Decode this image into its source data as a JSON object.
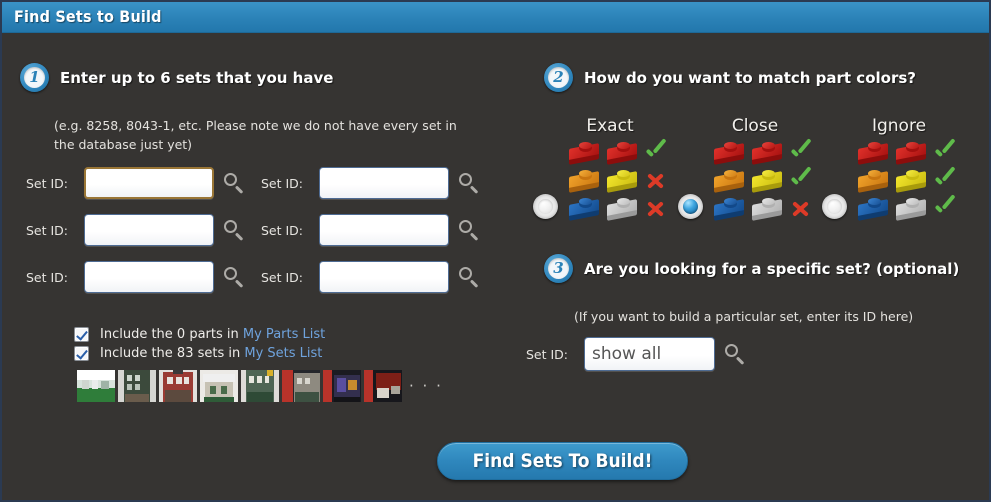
{
  "window": {
    "title": "Find Sets to Build"
  },
  "theme": {
    "titlebar": "#2b82b7",
    "background": "#363432",
    "accent": "#2f87bd",
    "link": "#6fa3dd",
    "focus_border": "#9a7636",
    "tick": "#5fbb4a",
    "cross": "#dd3a27"
  },
  "step1": {
    "number": "1",
    "title": "Enter up to 6 sets that you have",
    "hint": "(e.g. 8258, 8043-1, etc. Please note we do not have every set in the database just yet)",
    "field_label": "Set ID:",
    "fields": [
      {
        "value": "",
        "placeholder": "",
        "focused": true
      },
      {
        "value": "",
        "placeholder": "",
        "focused": false
      },
      {
        "value": "",
        "placeholder": "",
        "focused": false
      },
      {
        "value": "",
        "placeholder": "",
        "focused": false
      },
      {
        "value": "",
        "placeholder": "",
        "focused": false
      },
      {
        "value": "",
        "placeholder": "",
        "focused": false
      }
    ],
    "search_icon": "search-icon",
    "checkboxes": [
      {
        "checked": true,
        "text_before": "Include the 0 parts in",
        "link": "My Parts List"
      },
      {
        "checked": true,
        "text_before": "Include the 83 sets in",
        "link": "My Sets List"
      }
    ],
    "thumbnails_overflow": "· · ·"
  },
  "step2": {
    "number": "2",
    "title": "How do you want to match part colors?",
    "columns": [
      {
        "label": "Exact",
        "selected": false,
        "rows": [
          {
            "left_color": "#c4161c",
            "right_color": "#c4161c",
            "mark": "tick"
          },
          {
            "left_color": "#e08a14",
            "right_color": "#e3d81d",
            "mark": "cross"
          },
          {
            "left_color": "#1a5fa8",
            "right_color": "#c8c8c8",
            "mark": "cross"
          }
        ]
      },
      {
        "label": "Close",
        "selected": true,
        "rows": [
          {
            "left_color": "#c4161c",
            "right_color": "#c4161c",
            "mark": "tick"
          },
          {
            "left_color": "#e08a14",
            "right_color": "#e3d81d",
            "mark": "tick"
          },
          {
            "left_color": "#1a5fa8",
            "right_color": "#c8c8c8",
            "mark": "cross"
          }
        ]
      },
      {
        "label": "Ignore",
        "selected": false,
        "rows": [
          {
            "left_color": "#c4161c",
            "right_color": "#c4161c",
            "mark": "tick"
          },
          {
            "left_color": "#e08a14",
            "right_color": "#e3d81d",
            "mark": "tick"
          },
          {
            "left_color": "#1a5fa8",
            "right_color": "#c8c8c8",
            "mark": "tick"
          }
        ]
      }
    ]
  },
  "step3": {
    "number": "3",
    "title": "Are you looking for a specific set? (optional)",
    "hint": "(If you want to build a particular set, enter its ID here)",
    "field_label": "Set ID:",
    "field_value": "show all",
    "search_icon": "search-icon"
  },
  "cta": {
    "label": "Find Sets To Build!"
  }
}
